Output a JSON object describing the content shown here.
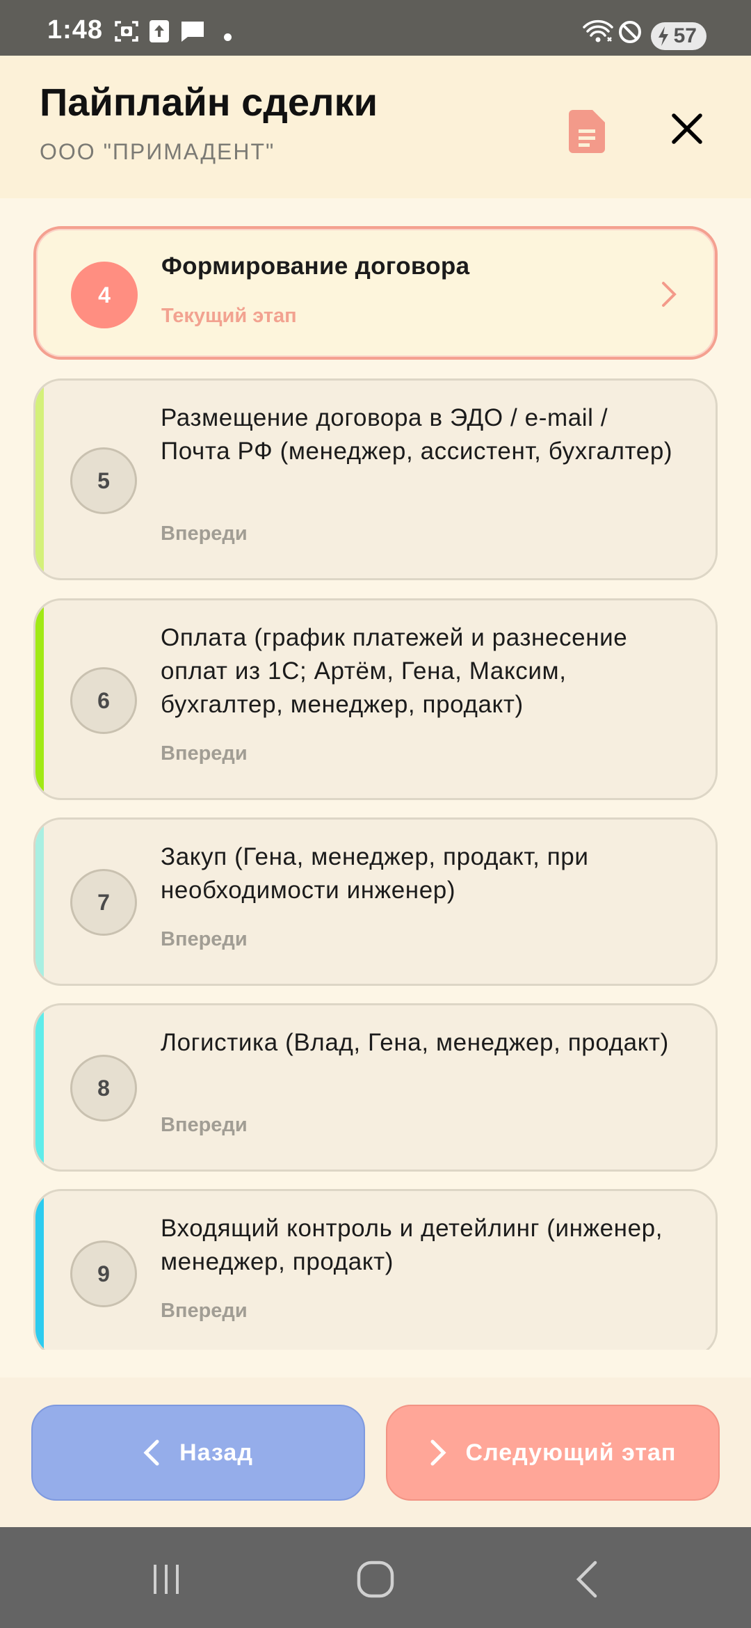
{
  "status_bar": {
    "time": "1:48",
    "battery_level": "57",
    "icons": [
      "screenshot-icon",
      "upload-icon",
      "message-icon",
      "notification-dot",
      "wifi-icon",
      "do-not-disturb-icon",
      "battery-charging-icon"
    ]
  },
  "header": {
    "title": "Пайплайн сделки",
    "subtitle": "ООО \"ПРИМАДЕНТ\"",
    "doc_icon": "document-icon",
    "close_icon": "close-icon",
    "accent_color": "#F39A8A"
  },
  "stages": [
    {
      "number": "4",
      "title": "Формирование договора",
      "status": "Текущий этап",
      "current": true
    },
    {
      "number": "5",
      "title": "Размещение договора в ЭДО / e-mail / Почта РФ (менеджер, ассистент, бухгалтер)",
      "status": "Впереди",
      "accent": "#D4F07A"
    },
    {
      "number": "6",
      "title": "Оплата (график платежей и разнесение оплат из 1С; Артём, Гена, Максим, бухгалтер, менеджер, продакт)",
      "status": "Впереди",
      "accent": "#A1E915"
    },
    {
      "number": "7",
      "title": "Закуп (Гена, менеджер, продакт, при необходимости инженер)",
      "status": "Впереди",
      "accent": "#A9EFE2"
    },
    {
      "number": "8",
      "title": "Логистика (Влад, Гена, менеджер, продакт)",
      "status": "Впереди",
      "accent": "#5FECEA"
    },
    {
      "number": "9",
      "title": "Входящий контроль и детейлинг (инженер, менеджер, продакт)",
      "status": "Впереди",
      "accent": "#2CCBEF"
    }
  ],
  "footer": {
    "back_label": "Назад",
    "next_label": "Следующий этап",
    "back_color": "#95ADEA",
    "next_color": "#FFA698"
  },
  "nav": {
    "recents_icon": "recents-icon",
    "home_icon": "home-icon",
    "back_icon": "back-icon"
  }
}
